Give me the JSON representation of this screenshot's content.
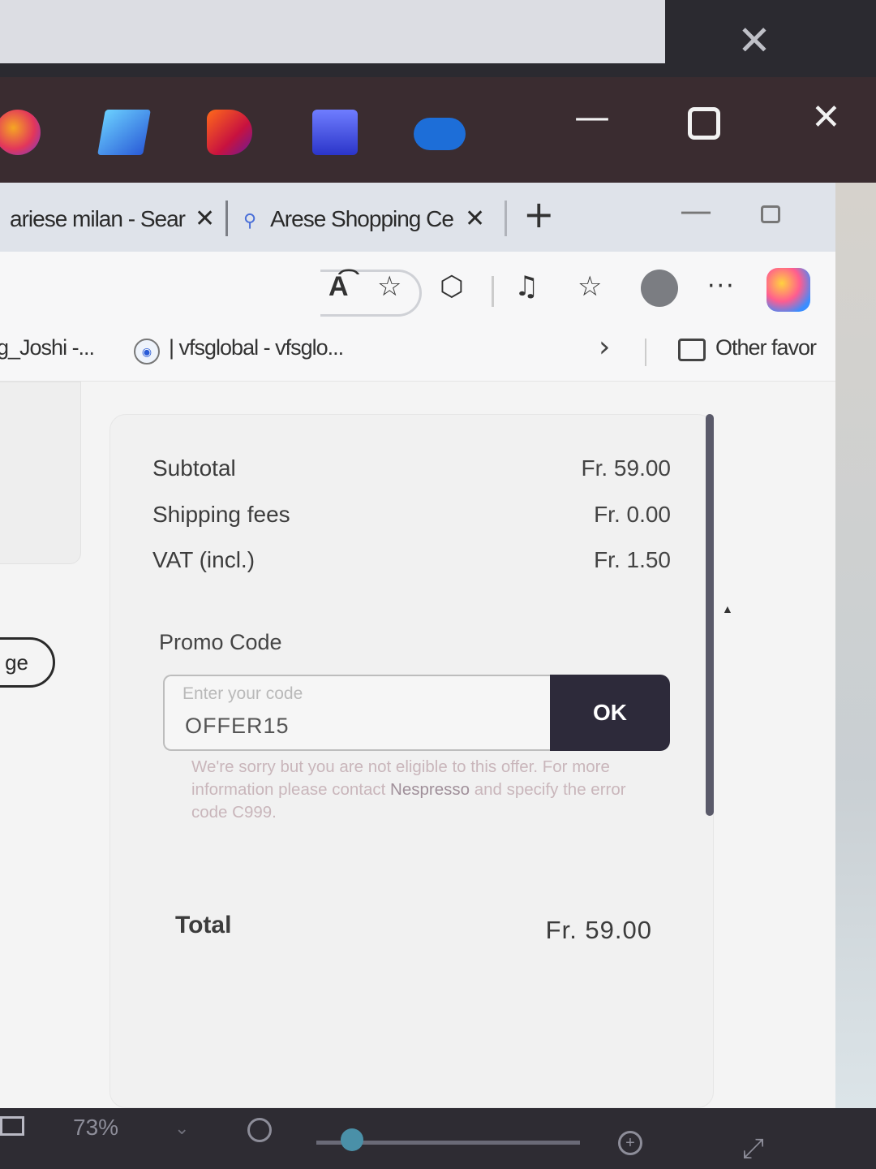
{
  "taskbar": {
    "icons": [
      "copilot-icon",
      "pen-icon",
      "power-icon",
      "grid-icon",
      "onedrive-icon"
    ],
    "window_controls": [
      "minimize-icon",
      "maximize-icon",
      "close-icon"
    ]
  },
  "browser": {
    "tabs": [
      {
        "label": "ariese milan - Sear",
        "close": "✕"
      },
      {
        "label": "Arese Shopping Ce",
        "close": "✕"
      }
    ],
    "new_tab": "+",
    "toolbar": {
      "read_aloud": "A͡",
      "more": "···"
    },
    "favorites": [
      {
        "label": "g_Joshi -..."
      },
      {
        "label": "| vfsglobal - vfsglo..."
      }
    ],
    "other_favorites": "Other favor"
  },
  "order_summary": {
    "rows": [
      {
        "label": "Subtotal",
        "value": "Fr. 59.00"
      },
      {
        "label": "Shipping fees",
        "value": "Fr. 0.00"
      },
      {
        "label": "VAT (incl.)",
        "value": "Fr. 1.50"
      }
    ],
    "promo": {
      "label": "Promo Code",
      "placeholder": "Enter your code",
      "value": "OFFER15",
      "button": "OK",
      "error_part1": "We're sorry but you are not eligible to this offer. For more information please contact",
      "error_brand": "Nespresso",
      "error_part2": "and specify the error code C999."
    },
    "total_label": "Total",
    "total_value": "Fr. 59.00"
  },
  "left_button": "ge",
  "statusbar": {
    "zoom": "73%",
    "zoom_level_percent": 73
  }
}
